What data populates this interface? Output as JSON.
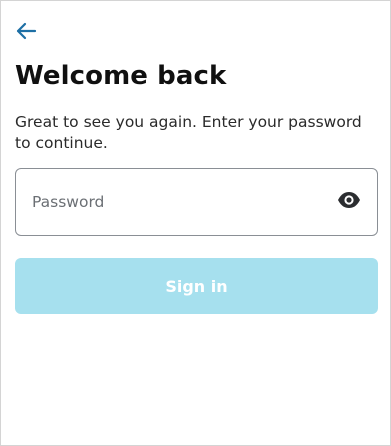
{
  "header": {
    "back_icon": "arrow-left-icon",
    "title": "Welcome back"
  },
  "main": {
    "subtitle": "Great to see you again. Enter your password to continue.",
    "password": {
      "placeholder": "Password",
      "value": "",
      "toggle_icon": "eye-icon"
    },
    "signin_label": "Sign in",
    "signin_enabled": false
  },
  "colors": {
    "accent": "#1d6fa5",
    "button_disabled_bg": "#a6e0ee",
    "field_border": "#8a8f95"
  }
}
